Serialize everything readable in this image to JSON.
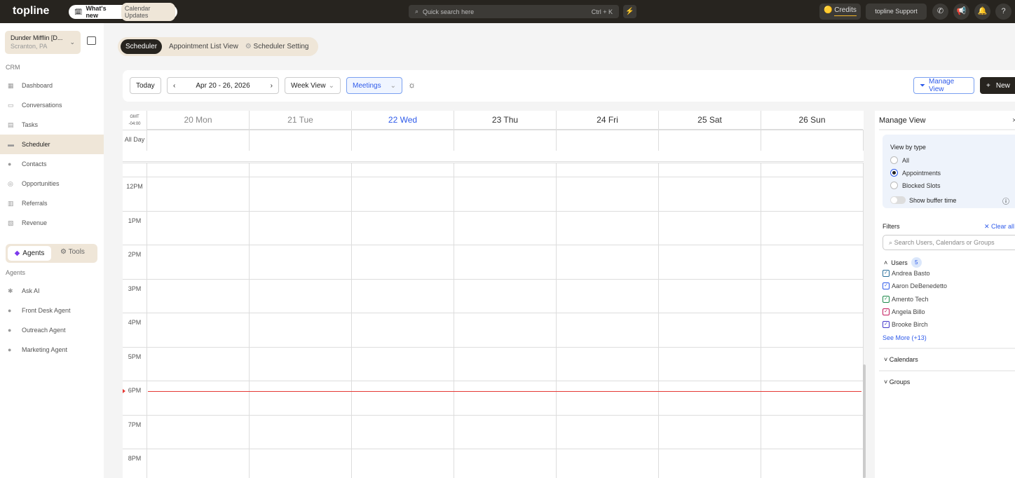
{
  "topbar": {
    "logo": "topline",
    "whats_new": "What's new",
    "calendar_updates": "Calendar Updates",
    "search_placeholder": "Quick search here",
    "search_shortcut": "Ctrl + K",
    "credits": "Credits",
    "support": "topline Support"
  },
  "sidebar": {
    "org_name": "Dunder Mifflin [D...",
    "org_location": "Scranton, PA",
    "crm_label": "CRM",
    "items": [
      {
        "label": "Dashboard",
        "icon": "dashboard-icon"
      },
      {
        "label": "Conversations",
        "icon": "chat-icon"
      },
      {
        "label": "Tasks",
        "icon": "tasks-icon"
      },
      {
        "label": "Scheduler",
        "icon": "calendar-icon",
        "active": true
      },
      {
        "label": "Contacts",
        "icon": "person-icon"
      },
      {
        "label": "Opportunities",
        "icon": "target-icon"
      },
      {
        "label": "Referrals",
        "icon": "referral-icon"
      },
      {
        "label": "Revenue",
        "icon": "revenue-icon"
      }
    ],
    "seg_agents": "Agents",
    "seg_tools": "Tools",
    "agents_label": "Agents",
    "agents": [
      {
        "label": "Ask AI"
      },
      {
        "label": "Front Desk Agent"
      },
      {
        "label": "Outreach Agent"
      },
      {
        "label": "Marketing Agent"
      }
    ]
  },
  "tabs": [
    {
      "label": "Scheduler",
      "active": true
    },
    {
      "label": "Appointment List View"
    },
    {
      "label": "Scheduler Setting"
    }
  ],
  "toolbar": {
    "today": "Today",
    "date_range": "Apr 20 - 26, 2026",
    "view": "Week View",
    "calendar_type": "Meetings",
    "manage_view": "Manage View",
    "new": "New"
  },
  "calendar": {
    "tz_line1": "GMT",
    "tz_line2": "-04:00",
    "all_day": "All Day",
    "days": [
      {
        "label": "20 Mon",
        "state": "past"
      },
      {
        "label": "21 Tue",
        "state": "past"
      },
      {
        "label": "22 Wed",
        "state": "today"
      },
      {
        "label": "23 Thu"
      },
      {
        "label": "24 Fri"
      },
      {
        "label": "25 Sat"
      },
      {
        "label": "26 Sun"
      }
    ],
    "hours": [
      "12PM",
      "1PM",
      "2PM",
      "3PM",
      "4PM",
      "5PM",
      "6PM",
      "7PM",
      "8PM"
    ],
    "current_time_color": "#e53935",
    "today_color": "#2f5bea"
  },
  "manage_view": {
    "title": "Manage View",
    "view_by_type": "View by type",
    "options": [
      {
        "label": "All",
        "selected": false
      },
      {
        "label": "Appointments",
        "selected": true
      },
      {
        "label": "Blocked Slots",
        "selected": false
      }
    ],
    "buffer_label": "Show buffer time",
    "buffer_on": false,
    "filters": "Filters",
    "clear_all": "Clear all",
    "search_placeholder": "Search Users, Calendars or Groups",
    "users_label": "Users",
    "users_count": "5",
    "users": [
      {
        "name": "Andrea Basto",
        "color": "#2a6f9b"
      },
      {
        "name": "Aaron DeBenedetto",
        "color": "#2f5bea"
      },
      {
        "name": "Amento Tech",
        "color": "#1f8a4c"
      },
      {
        "name": "Angela Billo",
        "color": "#c2185b"
      },
      {
        "name": "Brooke Birch",
        "color": "#4338ca"
      }
    ],
    "see_more": "See More (+13)",
    "calendars": "Calendars",
    "groups": "Groups"
  }
}
